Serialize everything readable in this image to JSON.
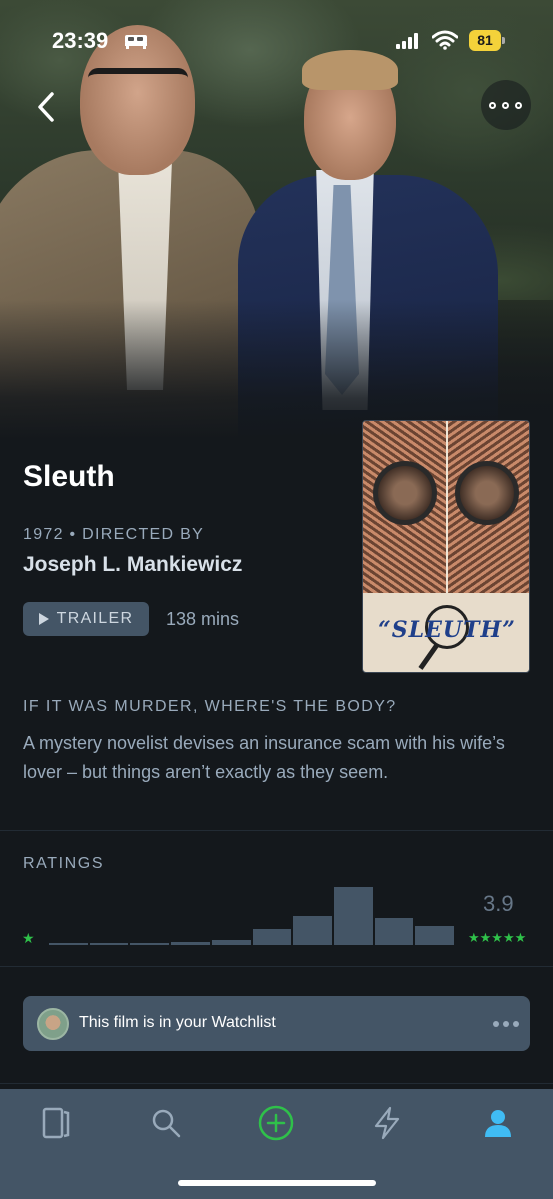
{
  "status_bar": {
    "time": "23:39",
    "battery": "81"
  },
  "film": {
    "title": "Sleuth",
    "meta": "1972 • DIRECTED BY",
    "director": "Joseph L. Mankiewicz",
    "trailer_label": "TRAILER",
    "runtime": "138 mins",
    "poster_title": "“SLEUTH”",
    "tagline": "IF IT WAS MURDER, WHERE'S THE BODY?",
    "synopsis": "A mystery novelist devises an insurance scam with his wife’s lover – but things aren’t exactly as they seem."
  },
  "ratings": {
    "heading": "RATINGS",
    "average": "3.9",
    "histogram_fractions": [
      0.03,
      0.03,
      0.03,
      0.05,
      0.08,
      0.28,
      0.5,
      1.0,
      0.47,
      0.32
    ],
    "min_star": "★",
    "max_stars": "★★★★★"
  },
  "watchlist": {
    "text": "This film is in your Watchlist"
  },
  "tabs": [
    {
      "icon": "film-strip-icon"
    },
    {
      "icon": "search-icon"
    },
    {
      "icon": "add-circle-icon"
    },
    {
      "icon": "activity-bolt-icon"
    },
    {
      "icon": "profile-icon"
    }
  ],
  "colors": {
    "background": "#14181c",
    "accent_green": "#2fc14a",
    "muted": "#99aabb",
    "bar": "#445566",
    "active_tab": "#40bcf4"
  }
}
